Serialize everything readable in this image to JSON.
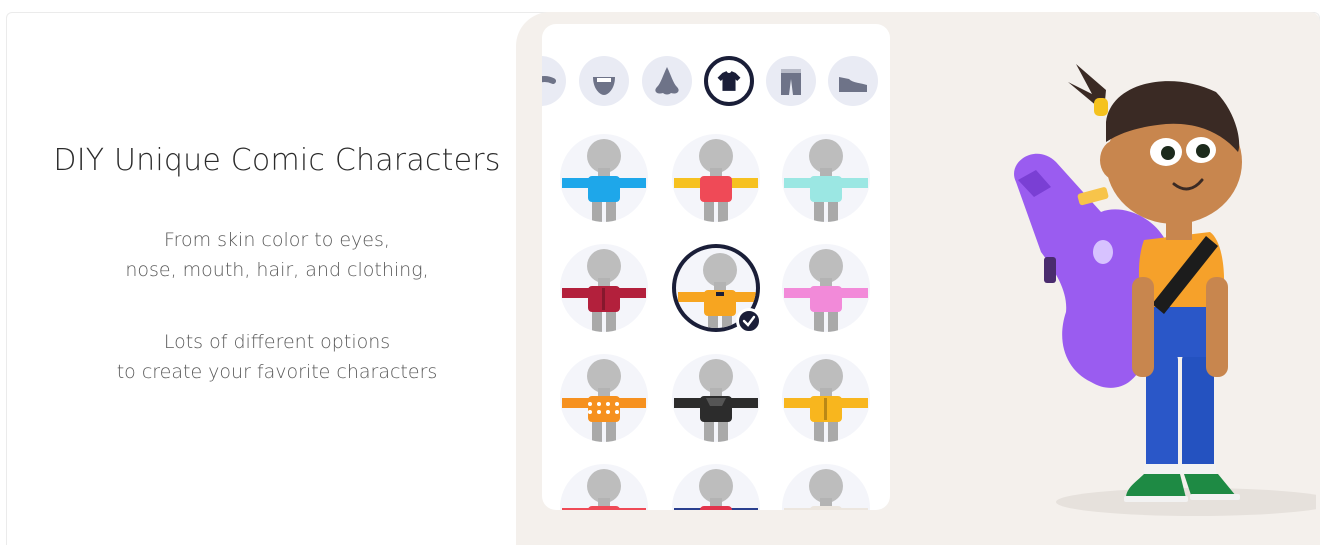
{
  "intro": {
    "headline": "DIY Unique Comic Characters",
    "paragraph1": [
      "From skin color to eyes,",
      "nose, mouth, hair, and clothing,"
    ],
    "paragraph2": [
      "Lots of different options",
      "to create your favorite characters"
    ]
  },
  "categories": [
    {
      "icon": "eyebrow-icon",
      "selected": false
    },
    {
      "icon": "mouth-icon",
      "selected": false
    },
    {
      "icon": "nose-icon",
      "selected": false
    },
    {
      "icon": "shirt-icon",
      "selected": true
    },
    {
      "icon": "pants-icon",
      "selected": false
    },
    {
      "icon": "shoe-icon",
      "selected": false
    }
  ],
  "clothing_options": [
    {
      "color": "#1ea7ea",
      "pattern": "plain",
      "selected": false
    },
    {
      "color": "#ef4a57",
      "pattern": "plain",
      "sleeve": "#f6c120",
      "selected": false
    },
    {
      "color": "#9be7e3",
      "pattern": "plain",
      "selected": false
    },
    {
      "color": "#b3203c",
      "pattern": "jacket",
      "selected": false
    },
    {
      "color": "#f7a520",
      "pattern": "polo",
      "selected": true
    },
    {
      "color": "#f28ad9",
      "pattern": "plain",
      "selected": false
    },
    {
      "color": "#f6911f",
      "pattern": "dots",
      "selected": false
    },
    {
      "color": "#2c2c2c",
      "pattern": "hoodie",
      "selected": false
    },
    {
      "color": "#f8b61e",
      "pattern": "jacket",
      "selected": false
    },
    {
      "color": "#ef4a57",
      "pattern": "plain",
      "selected": false
    },
    {
      "color": "#e2344c",
      "pattern": "plain",
      "sleeve": "#2a3f8f",
      "selected": false
    },
    {
      "color": "#ece6df",
      "pattern": "plain",
      "selected": false
    }
  ],
  "colors": {
    "accent_dark": "#1a1e38",
    "icon_gray": "#6e7388",
    "stage_bg": "#f4f0ec"
  }
}
